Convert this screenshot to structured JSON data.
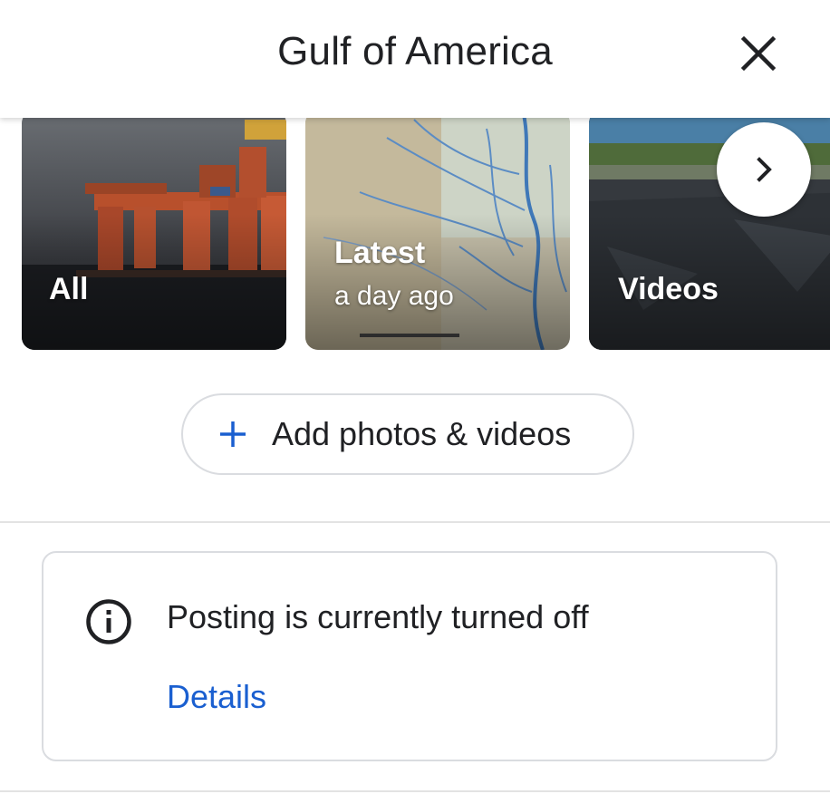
{
  "header": {
    "title": "Gulf of America",
    "close_icon": "close-icon"
  },
  "photo_strip": {
    "tiles": [
      {
        "label": "All",
        "subtitle": "",
        "image": "oil-rig-photo"
      },
      {
        "label": "Latest",
        "subtitle": "a day ago",
        "image": "river-map-photo"
      },
      {
        "label": "Videos",
        "subtitle": "",
        "image": "shoreline-photo"
      }
    ],
    "next_icon": "chevron-right-icon"
  },
  "add_button": {
    "label": "Add photos & videos",
    "icon": "plus-icon"
  },
  "notice": {
    "icon": "info-icon",
    "text": "Posting is currently turned off",
    "link_label": "Details"
  },
  "colors": {
    "accent": "#1a5fd0",
    "text": "#202124",
    "border": "#dadce0"
  }
}
